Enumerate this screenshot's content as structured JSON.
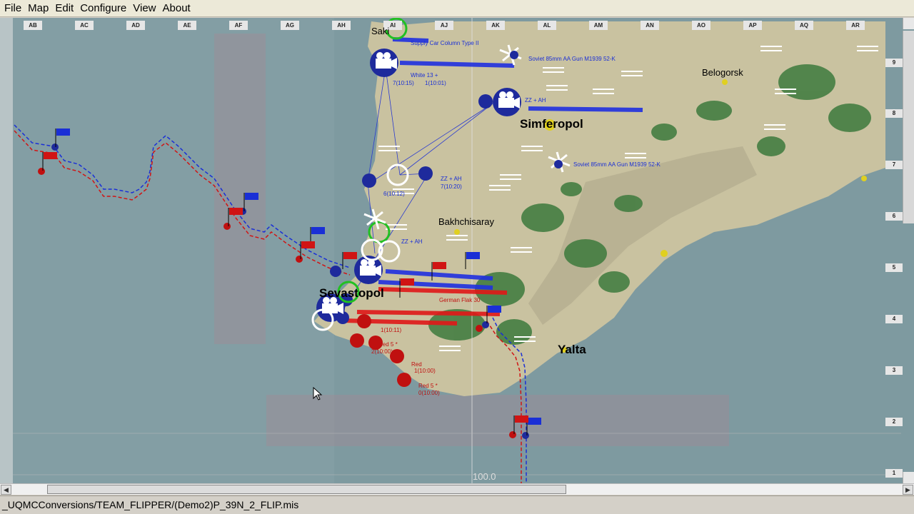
{
  "menu": [
    "File",
    "Map",
    "Edit",
    "Configure",
    "View",
    "About"
  ],
  "grid": {
    "columns": [
      "AB",
      "AC",
      "AD",
      "AE",
      "AF",
      "AG",
      "AH",
      "AI",
      "AJ",
      "AK",
      "AL",
      "AM",
      "AN",
      "AO",
      "AP",
      "AQ",
      "AR"
    ],
    "rows": [
      "9",
      "8",
      "7",
      "6",
      "5",
      "4",
      "3",
      "2",
      "1"
    ]
  },
  "cities": {
    "belogorsk": "Belogorsk",
    "simferopol": "Simferopol",
    "bakhchisaray": "Bakhchisaray",
    "yalta": "Yalta",
    "sevastopol": "Sevastopol",
    "saki": "Saki"
  },
  "units": {
    "aa_gun_1": "Soviet 85mm AA Gun M1939 52-K",
    "aa_gun_2": "Soviet 85mm AA Gun M1939 52-K",
    "supply": "Supply Car Column Type II",
    "white13": "White 13 +",
    "white13_time": "7(10:15)",
    "t10_01": "1(10:01)",
    "zz_ah_1": "ZZ + AH",
    "zz_ah_2": "ZZ + AH",
    "zz_ah_3": "ZZ + AH",
    "t10_20": "7(10:20)",
    "t10_12": "6(10:12)",
    "flak": "German Flak 30",
    "red5_1": "Red 5 *",
    "red5_2": "Red 5 *",
    "red5_2_time": "0(10:00)",
    "red_t1": "1(10:00)",
    "red_t2": "2(10:00)",
    "red_t3": "1(10:11)",
    "red_small": "Red"
  },
  "scale": "100.0",
  "status": "_UQMCConversions/TEAM_FLIPPER/(Demo2)P_39N_2_FLIP.mis",
  "colors": {
    "sea": "#7e9aa0",
    "land": "#c9c2a0",
    "blue": "#1a2fd6",
    "red": "#d01414",
    "green": "#3d7a3d"
  }
}
